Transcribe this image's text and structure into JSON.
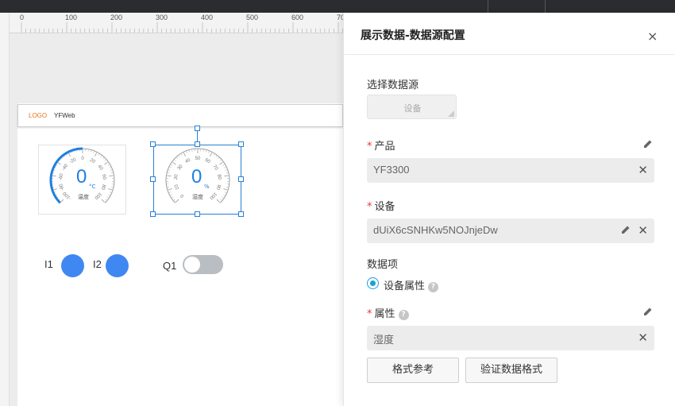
{
  "ruler": {
    "ticks": [
      "0",
      "100",
      "200",
      "300",
      "400",
      "500",
      "600",
      "70"
    ]
  },
  "header": {
    "logo": "LOGO",
    "site_name": "YFWeb"
  },
  "gauge1": {
    "value": "0",
    "unit": "°C",
    "name": "温度",
    "scale": [
      "-100",
      "-80",
      "-60",
      "-40",
      "-20",
      "0",
      "20",
      "40",
      "60",
      "80",
      "100"
    ],
    "min": -100,
    "max": 100
  },
  "gauge2": {
    "value": "0",
    "unit": "%",
    "name": "湿度",
    "scale": [
      "0",
      "10",
      "20",
      "30",
      "40",
      "50",
      "60",
      "70",
      "80",
      "90",
      "100"
    ],
    "min": 0,
    "max": 100
  },
  "io": {
    "i1": "I1",
    "i2": "I2",
    "q1": "Q1",
    "q1_on": false
  },
  "panel": {
    "title": "展示数据-数据源配置",
    "close_icon": "×",
    "source_label": "选择数据源",
    "source_button": "设备",
    "product_label": "产品",
    "product_value": "YF3300",
    "device_label": "设备",
    "device_value": "dUiX6cSNHKw5NOJnjeDw",
    "dataitem_label": "数据项",
    "radio_label": "设备属性",
    "attr_label": "属性",
    "attr_value": "湿度",
    "clear_icon": "✕",
    "help_icon": "?",
    "required_mark": "*",
    "format_ref_button": "格式参考",
    "validate_button": "验证数据格式"
  },
  "colors": {
    "accent": "#3f88f2",
    "gauge_value": "#1d80e0",
    "required": "#e53935",
    "radio": "#1aa0d8",
    "logo": "#e6761c"
  }
}
